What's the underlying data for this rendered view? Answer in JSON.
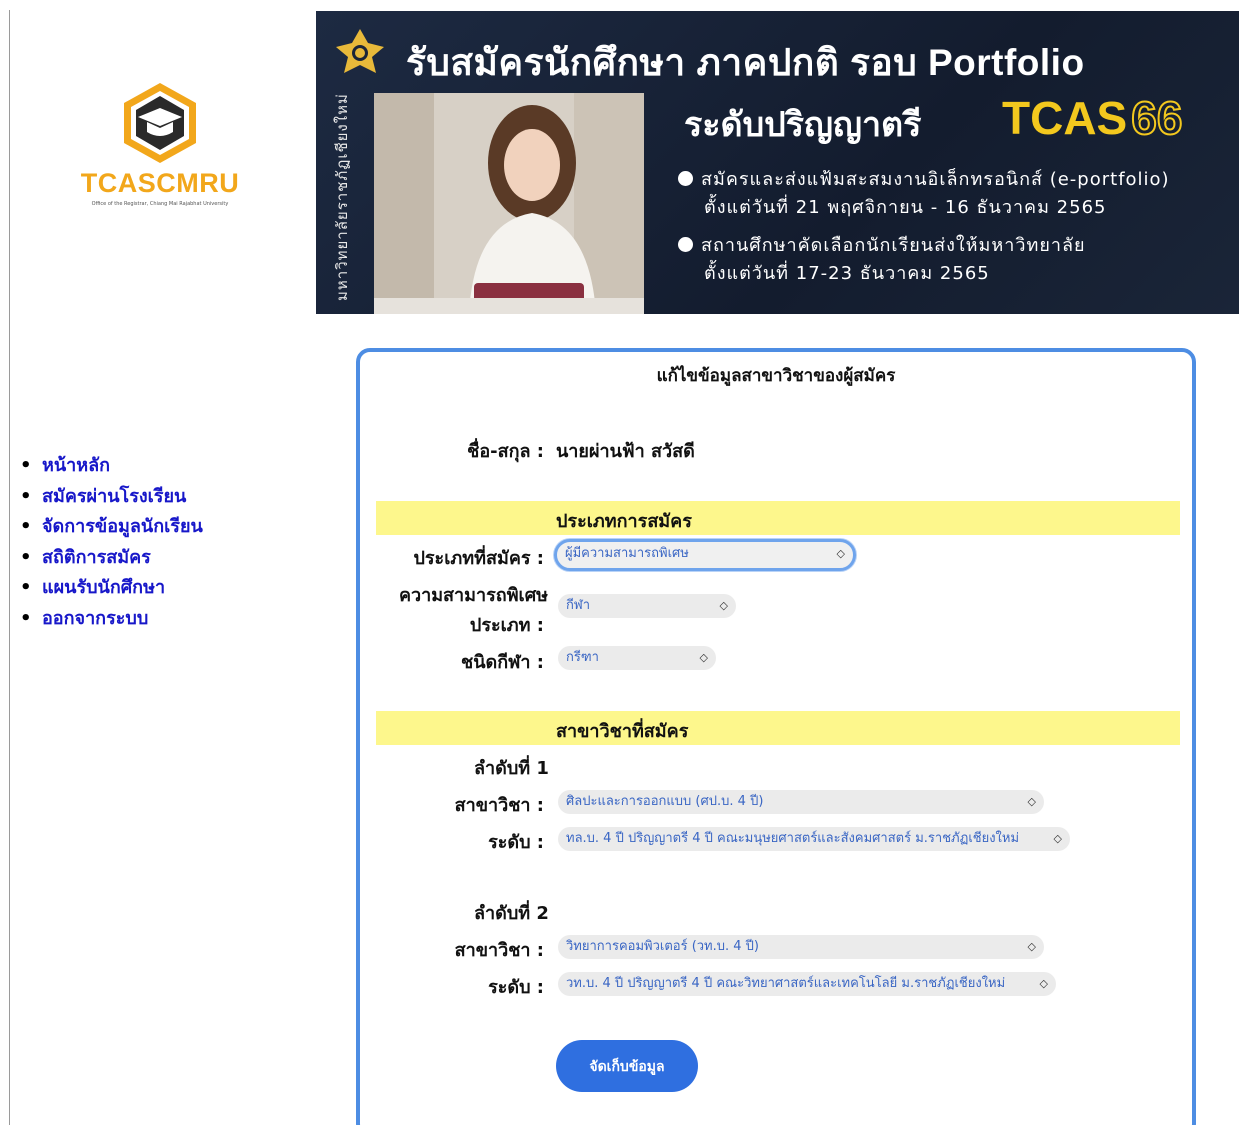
{
  "logo": {
    "name": "TCASCMRU",
    "subtitle": "Office of the Registrar, Chiang Mai Rajabhat University"
  },
  "banner": {
    "side_text": "มหาวิทยาลัยราชภัฏเชียงใหม่",
    "title": "รับสมัครนักศึกษา ภาคปกติ รอบ Portfolio",
    "level": "ระดับปริญญาตรี",
    "tcas": "TCAS",
    "tcas_year": "66",
    "bullets": [
      {
        "line1": "สมัครและส่งแฟ้มสะสมงานอิเล็กทรอนิกส์ (e-portfolio)",
        "line2": "ตั้งแต่วันที่ 21 พฤศจิกายน - 16 ธันวาคม 2565"
      },
      {
        "line1": "สถานศึกษาคัดเลือกนักเรียนส่งให้มหาวิทยาลัย",
        "line2": "ตั้งแต่วันที่ 17-23 ธันวาคม 2565"
      }
    ]
  },
  "nav": {
    "items": [
      "หน้าหลัก",
      "สมัครผ่านโรงเรียน",
      "จัดการข้อมูลนักเรียน",
      "สถิติการสมัคร",
      "แผนรับนักศึกษา",
      "ออกจากระบบ"
    ]
  },
  "form": {
    "title": "แก้ไขข้อมูลสาขาวิชาของผู้สมัคร",
    "name_label": "ชื่อ-สกุล :",
    "name_value": "นายผ่านฟ้า  สวัสดี",
    "section_type": "ประเภทการสมัคร",
    "type_label": "ประเภทที่สมัคร :",
    "type_value": "ผู้มีความสามารถพิเศษ",
    "talent_label_1": "ความสามารถพิเศษ",
    "talent_label_2": "ประเภท :",
    "talent_value": "กีฬา",
    "sport_label": "ชนิดกีฬา :",
    "sport_value": "กรีฑา",
    "section_major": "สาขาวิชาที่สมัคร",
    "choices": [
      {
        "order": "ลำดับที่ 1",
        "major_label": "สาขาวิชา :",
        "major_value": "ศิลปะและการออกแบบ (ศป.บ. 4 ปี)",
        "level_label": "ระดับ :",
        "level_value": "ทล.บ. 4 ปี ปริญญาตรี 4 ปี คณะมนุษยศาสตร์และสังคมศาสตร์ ม.ราชภัฏเชียงใหม่"
      },
      {
        "order": "ลำดับที่ 2",
        "major_label": "สาขาวิชา :",
        "major_value": "วิทยาการคอมพิวเตอร์ (วท.บ. 4 ปี)",
        "level_label": "ระดับ :",
        "level_value": "วท.บ. 4 ปี ปริญญาตรี 4 ปี คณะวิทยาศาสตร์และเทคโนโลยี ม.ราชภัฏเชียงใหม่"
      }
    ],
    "save_label": "จัดเก็บข้อมูล"
  },
  "colors": {
    "nav_link": "#1717c9",
    "panel_border": "#4d8de3",
    "band": "#fdf78c",
    "button": "#2f6fe0",
    "logo": "#f2a71b",
    "banner_bg": "#1b2538",
    "banner_accent": "#f3c81e"
  }
}
